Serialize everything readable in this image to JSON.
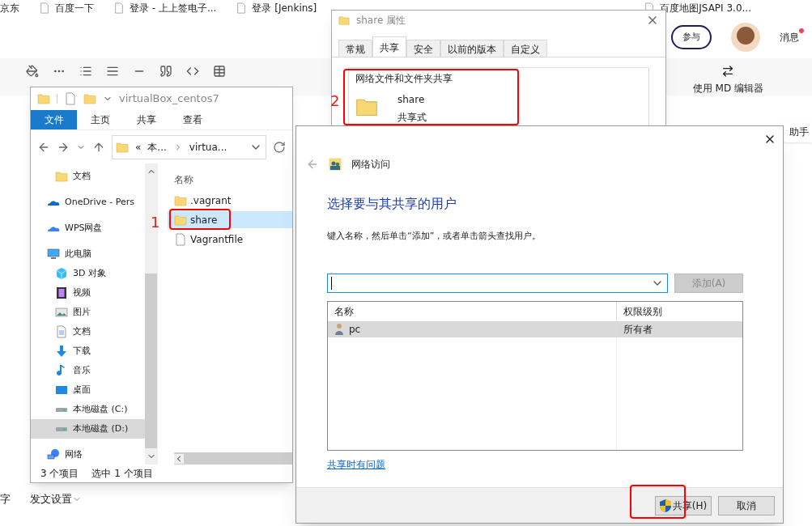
{
  "bookmarks": [
    {
      "label": "京东"
    },
    {
      "label": "百度一下"
    },
    {
      "label": "登录 - 上上签电子..."
    },
    {
      "label": "登录 [Jenkins]"
    },
    {
      "label": "百度地图JSAPI 3.0..."
    }
  ],
  "editor_header": {
    "join_button": "参与",
    "messages": "消息",
    "notification": true
  },
  "editor_toolbar": {
    "md_button": "使用 MD 编辑器"
  },
  "assistant_tab": "助手",
  "bottom_bar": {
    "left_text": "字",
    "publish_settings": "发文设置"
  },
  "explorer": {
    "title": "virtualBox_centos7",
    "ribbon_tabs": [
      {
        "label": "文件",
        "selected": true
      },
      {
        "label": "主页",
        "selected": false
      },
      {
        "label": "共享",
        "selected": false
      },
      {
        "label": "查看",
        "selected": false
      }
    ],
    "breadcrumb": [
      "«",
      "本...",
      "virtua..."
    ],
    "nav_scrolled_children": [
      {
        "label": "文档",
        "kind": "folder",
        "selected": false
      }
    ],
    "nav_items": [
      {
        "label": "OneDrive - Pers",
        "kind": "onedrive",
        "selected": false
      },
      {
        "label": "WPS网盘",
        "kind": "cloud",
        "selected": false
      },
      {
        "label": "此电脑",
        "kind": "pc",
        "selected": false,
        "children": [
          {
            "label": "3D 对象",
            "kind": "cube",
            "selected": false
          },
          {
            "label": "视频",
            "kind": "video",
            "selected": false
          },
          {
            "label": "图片",
            "kind": "picture",
            "selected": false
          },
          {
            "label": "文档",
            "kind": "document",
            "selected": false
          },
          {
            "label": "下载",
            "kind": "download",
            "selected": false
          },
          {
            "label": "音乐",
            "kind": "music",
            "selected": false
          },
          {
            "label": "桌面",
            "kind": "desktop",
            "selected": false
          },
          {
            "label": "本地磁盘 (C:)",
            "kind": "drive",
            "selected": false
          },
          {
            "label": "本地磁盘 (D:)",
            "kind": "drive",
            "selected": true
          }
        ]
      },
      {
        "label": "网络",
        "kind": "network",
        "selected": false
      }
    ],
    "column_header": "名称",
    "files": [
      {
        "name": ".vagrant",
        "kind": "folder",
        "selected": false
      },
      {
        "name": "share",
        "kind": "folder",
        "selected": true
      },
      {
        "name": "Vagrantfile",
        "kind": "file",
        "selected": false
      }
    ],
    "status": [
      "3 个项目",
      "选中 1 个项目"
    ]
  },
  "properties": {
    "title": "share 属性",
    "tabs": [
      {
        "label": "常规",
        "selected": false
      },
      {
        "label": "共享",
        "selected": true
      },
      {
        "label": "安全",
        "selected": false
      },
      {
        "label": "以前的版本",
        "selected": false
      },
      {
        "label": "自定义",
        "selected": false
      }
    ],
    "group_title": "网络文件和文件夹共享",
    "folder_name": "share",
    "folder_status": "共享式"
  },
  "dialog": {
    "nav_title": "网络访问",
    "heading": "选择要与其共享的用户",
    "instruction": "键入名称，然后单击“添加”，或者单击箭头查找用户。",
    "add_button": {
      "label": "添加(A)",
      "disabled": true
    },
    "columns": [
      "名称",
      "权限级别"
    ],
    "rows": [
      {
        "name": "pc",
        "permission": "所有者",
        "selected": true
      }
    ],
    "help_link": "共享时有问题",
    "buttons": [
      {
        "label": "共享(H)",
        "kind": "shield"
      },
      {
        "label": "取消",
        "kind": "plain"
      }
    ]
  },
  "markers": [
    {
      "label": "1"
    },
    {
      "label": "2"
    }
  ]
}
